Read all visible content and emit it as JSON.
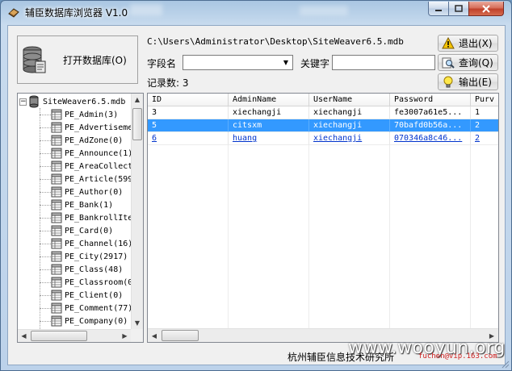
{
  "window": {
    "title": "辅臣数据库浏览器 V1.0"
  },
  "toolbar": {
    "open_db_label": "打开数据库(O)",
    "db_path": "C:\\Users\\Administrator\\Desktop\\SiteWeaver6.5.mdb",
    "field_label": "字段名",
    "field_value": "",
    "keyword_label": "关键字",
    "keyword_value": "",
    "record_count_label": "记录数: 3"
  },
  "side_buttons": {
    "exit_label": "退出(X)",
    "query_label": "查询(Q)",
    "output_label": "输出(E)"
  },
  "tree": {
    "root_label": "SiteWeaver6.5.mdb",
    "items": [
      "PE_Admin(3)",
      "PE_Advertiseme",
      "PE_AdZone(0)",
      "PE_Announce(1)",
      "PE_AreaCollect",
      "PE_Article(599",
      "PE_Author(0)",
      "PE_Bank(1)",
      "PE_BankrollIte",
      "PE_Card(0)",
      "PE_Channel(16)",
      "PE_City(2917)",
      "PE_Class(48)",
      "PE_Classroom(0",
      "PE_Client(0)",
      "PE_Comment(77)",
      "PE_Company(0)"
    ]
  },
  "grid": {
    "columns": [
      "ID",
      "AdminName",
      "UserName",
      "Password",
      "Purv"
    ],
    "rows": [
      {
        "cells": [
          "3",
          "xiechangji",
          "xiechangji",
          "fe3007a61e5...",
          "1"
        ],
        "state": "normal"
      },
      {
        "cells": [
          "5",
          "citsxm",
          "xiechangji",
          "70bafd0b56a...",
          "2"
        ],
        "state": "selected"
      },
      {
        "cells": [
          "6",
          "huang",
          "xiechangji",
          "070346a8c46...",
          "2"
        ],
        "state": "link"
      }
    ]
  },
  "footer": {
    "company": "杭州辅臣信息技术研究所",
    "watermark": "www.wooyun.org",
    "watermark_small": "fuchen@vip.163.com"
  },
  "colors": {
    "selection": "#3399ff",
    "link": "#0033cc"
  }
}
